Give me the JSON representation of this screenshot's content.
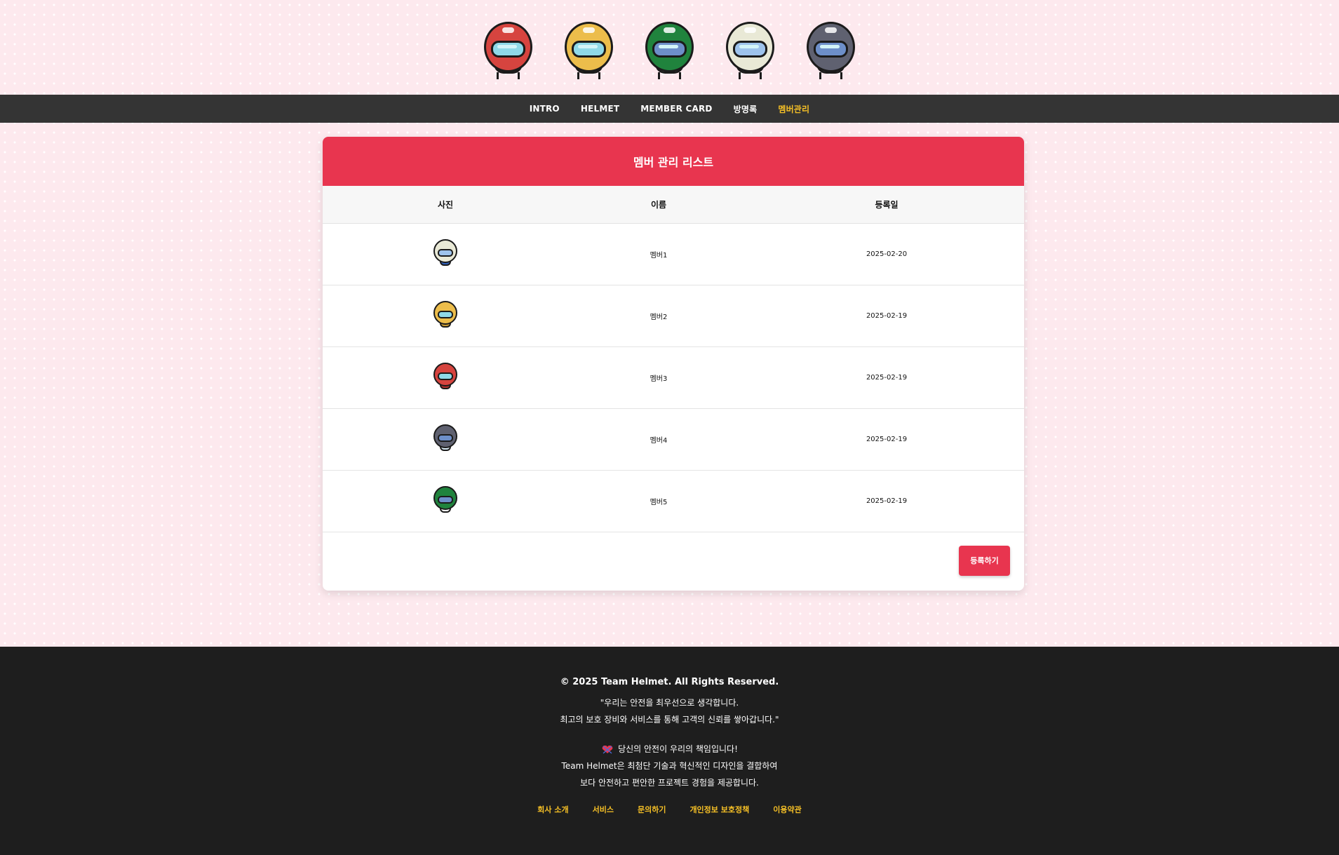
{
  "helmets": [
    {
      "name": "red-helmet",
      "color": "#d6443f"
    },
    {
      "name": "yellow-helmet",
      "color": "#ecbd4b"
    },
    {
      "name": "green-helmet",
      "color": "#20833d"
    },
    {
      "name": "white-helmet",
      "color": "#e9e9d6"
    },
    {
      "name": "gray-helmet",
      "color": "#5f6170"
    }
  ],
  "nav": {
    "items": [
      "INTRO",
      "HELMET",
      "MEMBER CARD",
      "방명록",
      "멤버관리"
    ],
    "active_index": 4
  },
  "card": {
    "title": "멤버 관리 리스트",
    "columns": [
      "사진",
      "이름",
      "등록일"
    ],
    "rows": [
      {
        "photo": "white-helmet-icon",
        "name": "멤버1",
        "date": "2025-02-20"
      },
      {
        "photo": "yellow-helmet-icon",
        "name": "멤버2",
        "date": "2025-02-19"
      },
      {
        "photo": "red-helmet-icon",
        "name": "멤버3",
        "date": "2025-02-19"
      },
      {
        "photo": "gray-helmet-icon",
        "name": "멤버4",
        "date": "2025-02-19"
      },
      {
        "photo": "green-helmet-icon",
        "name": "멤버5",
        "date": "2025-02-19"
      }
    ],
    "register_button": "등록하기"
  },
  "footer": {
    "copyright": "© 2025 Team Helmet. All Rights Reserved.",
    "quote_line1": "\"우리는 안전을 최우선으로 생각합니다.",
    "quote_line2": "최고의 보호 장비와 서비스를 통해 고객의 신뢰를 쌓아갑니다.\"",
    "note_line1": "당신의 안전이 우리의 책임입니다!",
    "note_line2": "Team Helmet은 최첨단 기술과 혁신적인 디자인을 결합하여",
    "note_line3": "보다 안전하고 편안한 프로젝트 경험을 제공합니다.",
    "links": [
      "회사 소개",
      "서비스",
      "문의하기",
      "개인정보 보호정책",
      "이용약관"
    ]
  },
  "colors": {
    "accent": "#e8354f",
    "nav_bg": "#343434",
    "nav_active": "#f6c026",
    "footer_bg": "#1e1e1e"
  }
}
